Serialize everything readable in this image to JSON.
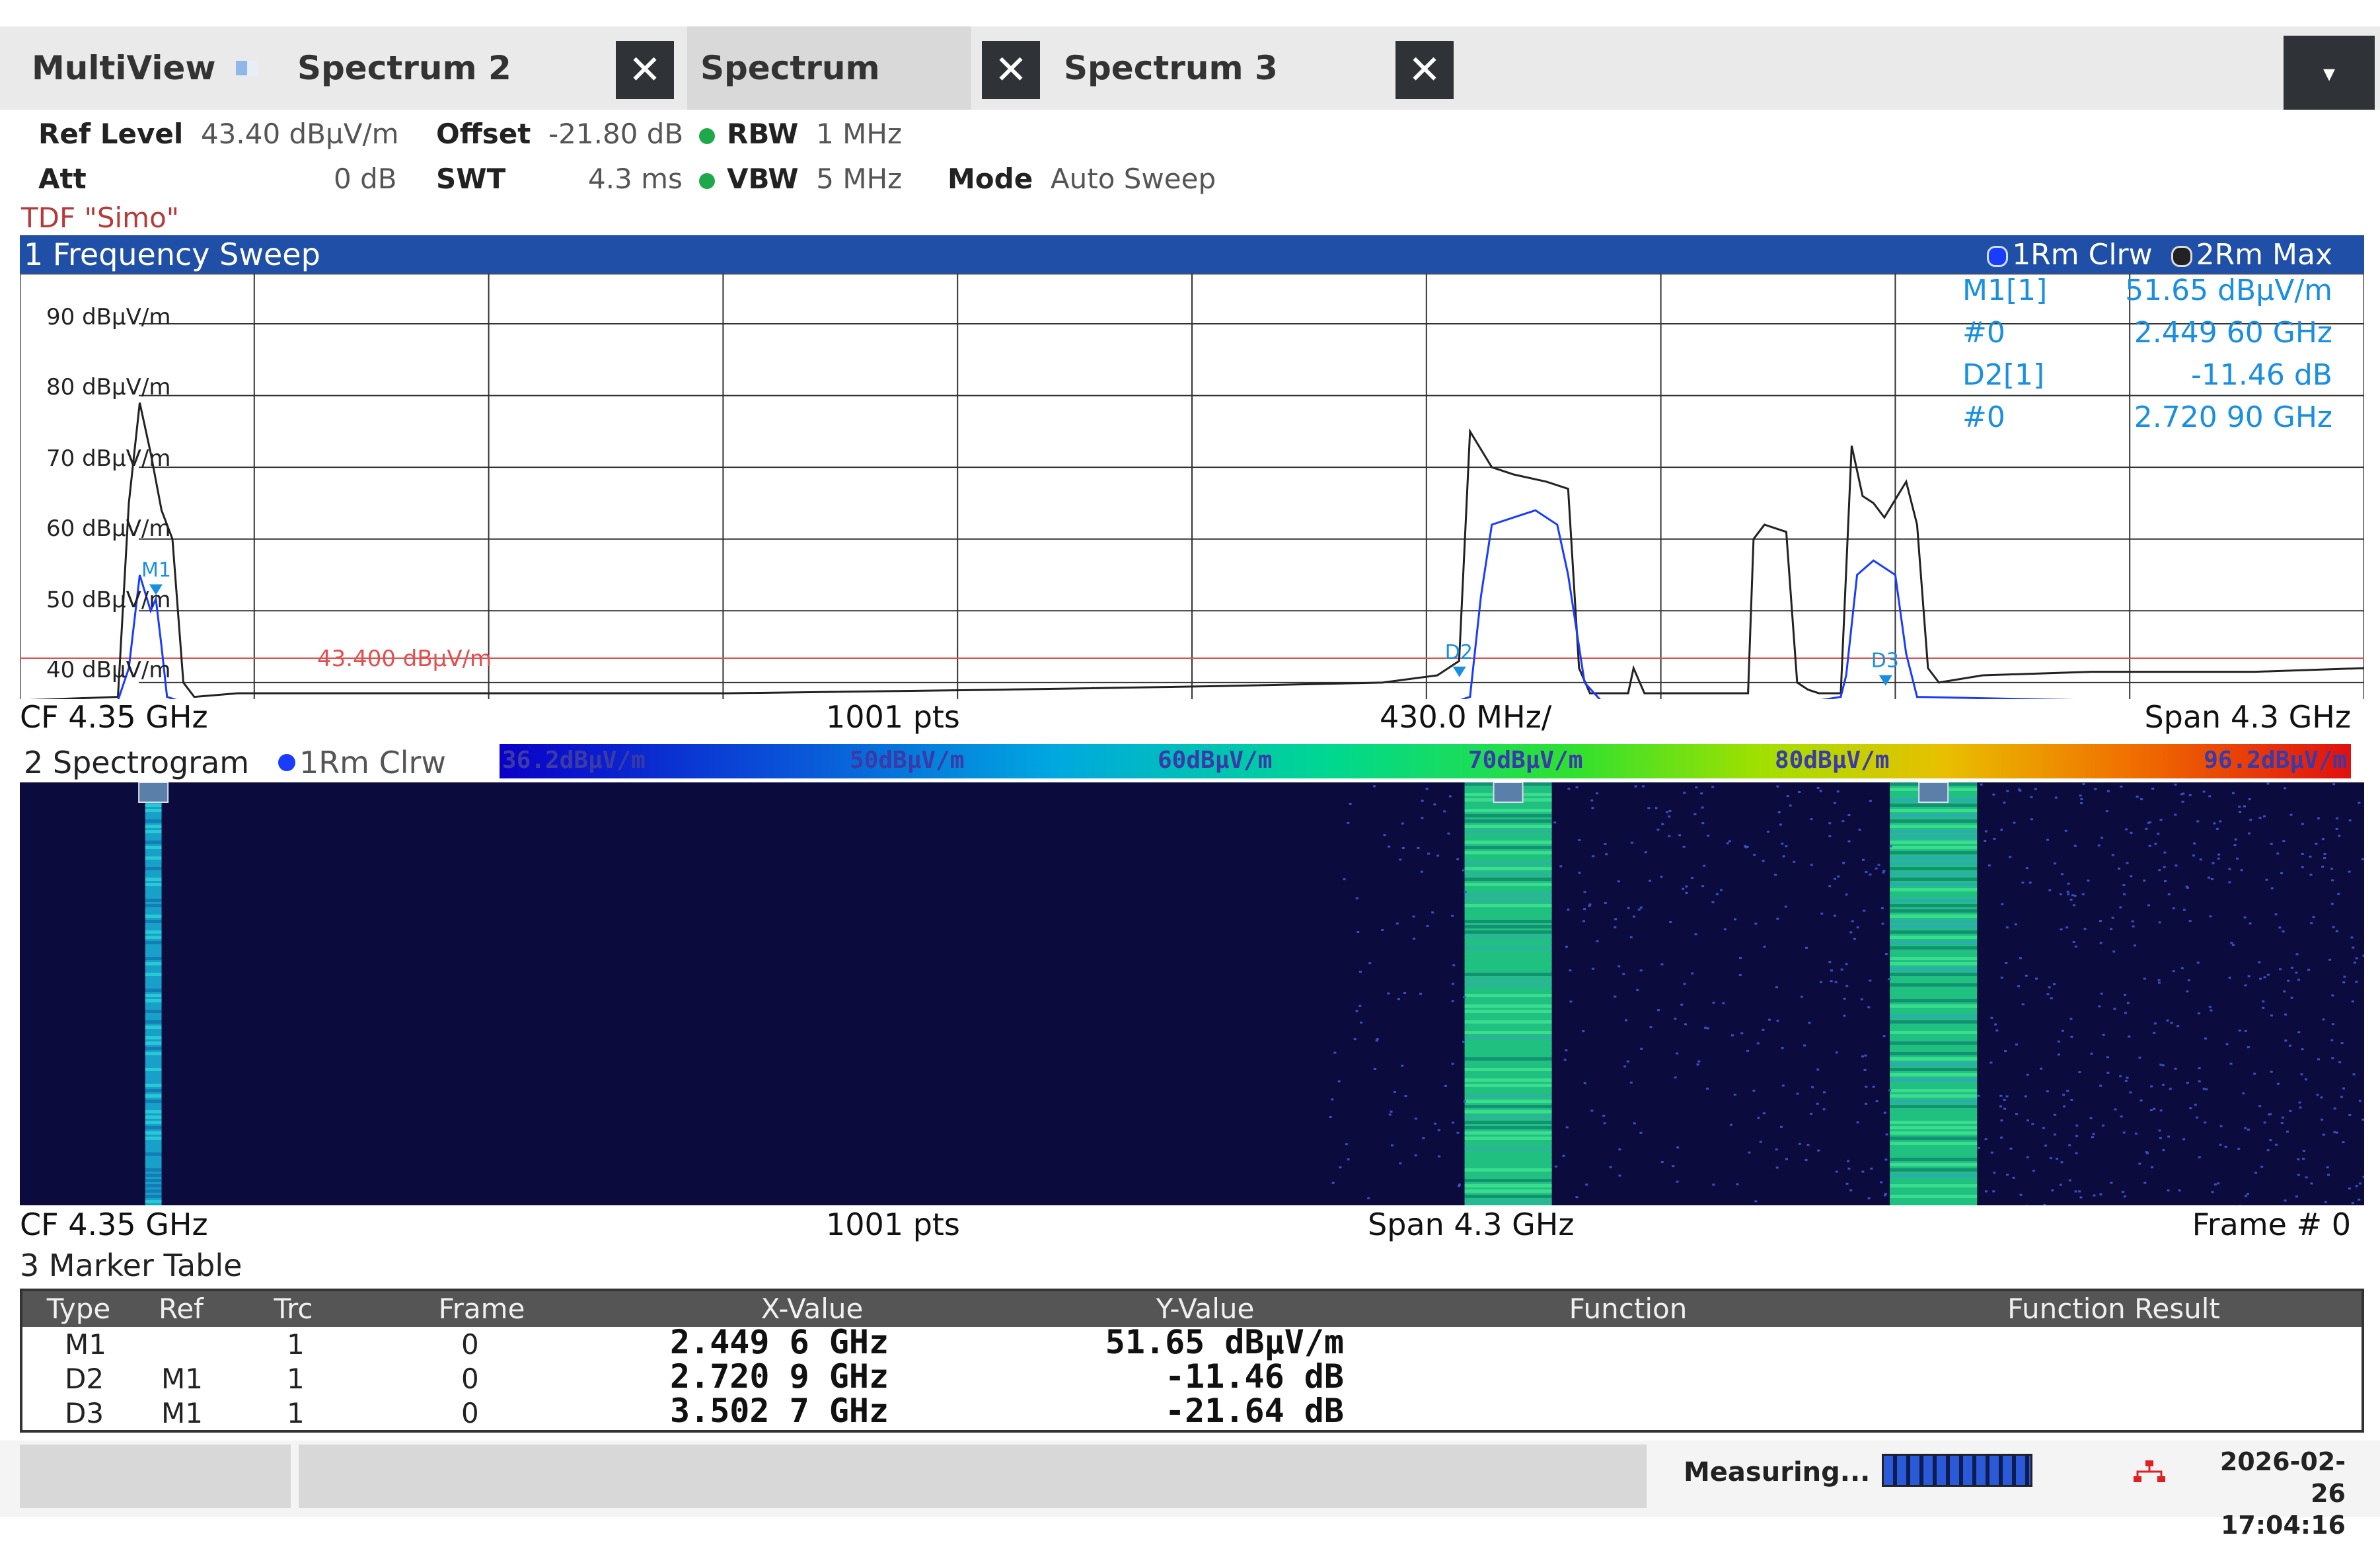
{
  "tabs": {
    "multiview": "MultiView",
    "items": [
      {
        "label": "Spectrum 2"
      },
      {
        "label": "Spectrum"
      },
      {
        "label": "Spectrum 3"
      }
    ],
    "close_glyph": "✕",
    "dropdown_glyph": "▾"
  },
  "settings": {
    "ref_level_label": "Ref Level",
    "ref_level_value": "43.40 dBµV/m",
    "offset_label": "Offset",
    "offset_value": "-21.80 dB",
    "rbw_label": "RBW",
    "rbw_value": "1 MHz",
    "att_label": "Att",
    "att_value": "0 dB",
    "swt_label": "SWT",
    "swt_value": "4.3 ms",
    "vbw_label": "VBW",
    "vbw_value": "5 MHz",
    "mode_label": "Mode",
    "mode_value": "Auto Sweep",
    "tdf": "TDF \"Simo\"",
    "indicator_color": "#1fa84a"
  },
  "sweep": {
    "title": "1 Frequency Sweep",
    "trace1": "1Rm Clrw",
    "trace2": "2Rm Max",
    "y_labels": [
      "90 dBµV/m",
      "80 dBµV/m",
      "70 dBµV/m",
      "60 dBµV/m",
      "50 dBµV/m",
      "40 dBµV/m"
    ],
    "limit_label": "43.400 dBµV/m",
    "marker_labels": {
      "m1": "M1",
      "d2": "D2",
      "d3": "D3"
    },
    "marker_info": [
      {
        "label": "M1[1]",
        "value": "51.65 dBµV/m"
      },
      {
        "label": "#0",
        "value": "2.449 60 GHz"
      },
      {
        "label": "D2[1]",
        "value": "-11.46 dB"
      },
      {
        "label": "#0",
        "value": "2.720 90 GHz"
      }
    ],
    "footer": {
      "cf": "CF 4.35 GHz",
      "pts": "1001 pts",
      "div": "430.0 MHz/",
      "span": "Span 4.3 GHz"
    },
    "colors": {
      "header": "#1f4fa6",
      "trace1": "#1a3cff",
      "trace2": "#222222",
      "limit": "#e05050",
      "marker": "#1a8fe0"
    }
  },
  "spectrogram": {
    "title": "2 Spectrogram",
    "trace": "1Rm Clrw",
    "scale": [
      "36.2dBµV/m",
      "50dBµV/m",
      "60dBµV/m",
      "70dBµV/m",
      "80dBµV/m",
      "96.2dBµV/m"
    ],
    "footer": {
      "cf": "CF 4.35 GHz",
      "pts": "1001 pts",
      "span": "Span 4.3 GHz",
      "frame": "Frame # 0"
    }
  },
  "marker_table": {
    "title": "3 Marker Table",
    "columns": [
      "Type",
      "Ref",
      "Trc",
      "Frame",
      "X-Value",
      "Y-Value",
      "Function",
      "Function Result"
    ],
    "rows": [
      {
        "type": "M1",
        "ref": "",
        "trc": "1",
        "frame": "0",
        "x": "2.449 6 GHz",
        "y": "51.65 dBµV/m"
      },
      {
        "type": "D2",
        "ref": "M1",
        "trc": "1",
        "frame": "0",
        "x": "2.720 9 GHz",
        "y": "-11.46 dB"
      },
      {
        "type": "D3",
        "ref": "M1",
        "trc": "1",
        "frame": "0",
        "x": "3.502 7 GHz",
        "y": "-21.64 dB"
      }
    ]
  },
  "status": {
    "measuring": "Measuring...",
    "date": "2026-02-26",
    "time": "17:04:16"
  },
  "chart_data": {
    "type": "line",
    "x_unit": "GHz",
    "y_unit": "dBµV/m",
    "xlim": [
      2.2,
      6.5
    ],
    "ylim": [
      37.5,
      97
    ],
    "limit_line": 43.4,
    "series": [
      {
        "name": "1Rm Clrw",
        "x": [
          2.2,
          2.38,
          2.4,
          2.42,
          2.44,
          2.4496,
          2.46,
          2.47,
          2.49,
          3.0,
          3.5,
          4.0,
          4.5,
          4.84,
          4.86,
          4.88,
          4.9,
          4.94,
          4.98,
          5.02,
          5.04,
          5.07,
          5.1,
          5.5,
          5.54,
          5.55,
          5.57,
          5.6,
          5.62,
          5.64,
          5.66,
          5.68,
          6.0,
          6.5
        ],
        "y": [
          37.5,
          37.5,
          42,
          55,
          50,
          51.65,
          45,
          38,
          37.5,
          37.5,
          37.5,
          37.5,
          37.5,
          37.5,
          38,
          52,
          62,
          63,
          64,
          62,
          55,
          40,
          37.5,
          37.5,
          38,
          41,
          55,
          57,
          56,
          55,
          44,
          38,
          37.5,
          37.5
        ]
      },
      {
        "name": "2Rm Max",
        "x": [
          2.2,
          2.38,
          2.4,
          2.42,
          2.44,
          2.46,
          2.48,
          2.5,
          2.52,
          2.6,
          3.0,
          3.5,
          4.0,
          4.4,
          4.7,
          4.8,
          4.84,
          4.86,
          4.9,
          4.94,
          5.0,
          5.04,
          5.06,
          5.08,
          5.1,
          5.15,
          5.16,
          5.18,
          5.2,
          5.3,
          5.37,
          5.38,
          5.4,
          5.44,
          5.46,
          5.48,
          5.5,
          5.54,
          5.56,
          5.58,
          5.6,
          5.62,
          5.66,
          5.68,
          5.7,
          5.72,
          5.8,
          6.0,
          6.3,
          6.5
        ],
        "y": [
          37.5,
          38,
          65,
          79,
          72,
          64,
          60,
          40,
          38,
          38.5,
          38.5,
          38.5,
          39,
          39.5,
          40,
          41,
          43,
          75,
          70,
          69,
          68,
          67,
          42,
          38.5,
          38.5,
          38.5,
          42,
          38.5,
          38.5,
          38.5,
          38.5,
          60,
          62,
          61,
          40,
          39,
          38.5,
          38.5,
          73,
          66,
          65,
          63,
          68,
          62,
          42,
          40,
          41,
          41.5,
          41.5,
          42
        ]
      }
    ],
    "markers": [
      {
        "name": "M1",
        "x": 2.4496,
        "y": 51.65
      },
      {
        "name": "D2",
        "x": 4.8405,
        "y": 40.19
      },
      {
        "name": "D3",
        "x": 5.6223,
        "y": 30.01
      }
    ]
  }
}
